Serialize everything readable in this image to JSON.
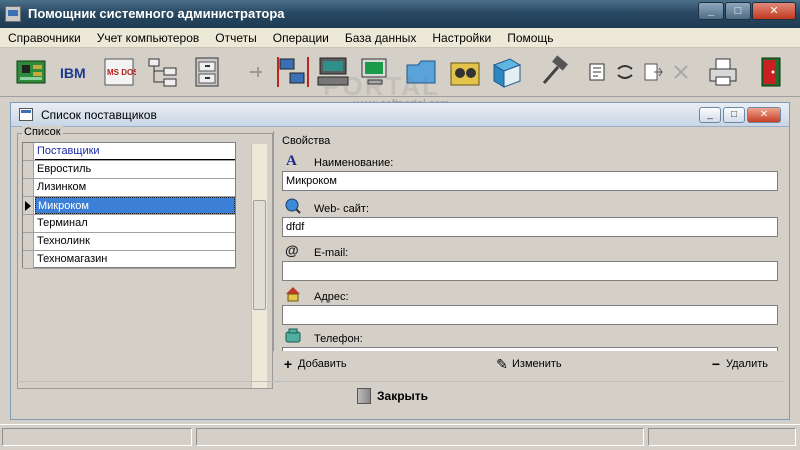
{
  "app": {
    "title": "Помощник системного администратора"
  },
  "window_buttons": {
    "minimize": "_",
    "maximize": "□",
    "close": "✕"
  },
  "menu": [
    {
      "label": "Справочники"
    },
    {
      "label": "Учет компьютеров"
    },
    {
      "label": "Отчеты"
    },
    {
      "label": "Операции"
    },
    {
      "label": "База данных"
    },
    {
      "label": "Настройки"
    },
    {
      "label": "Помощь"
    }
  ],
  "toolbar": {
    "ibm_label": "IBM",
    "msdos_label": "MS DOS",
    "watermark": "PORTAL",
    "watermark_url": "www.softportal.com"
  },
  "child_window": {
    "title": "Список поставщиков",
    "buttons": {
      "minimize": "_",
      "maximize": "□",
      "close": "✕"
    }
  },
  "list": {
    "legend": "Список",
    "header": "Поставщики",
    "rows": [
      "Евростиль",
      "Лизинком",
      "Микроком",
      "Терминал",
      "Технолинк",
      "Техномагазин"
    ],
    "selected": "Микроком"
  },
  "properties": {
    "title": "Свойства",
    "fields": [
      {
        "label": "Наименование:",
        "value": "Микроком"
      },
      {
        "label": "Web- сайт:",
        "value": "dfdf"
      },
      {
        "label": "E-mail:",
        "value": ""
      },
      {
        "label": "Адрес:",
        "value": ""
      },
      {
        "label": "Телефон:",
        "value": ""
      }
    ]
  },
  "actions": {
    "add": "Добавить",
    "edit": "Изменить",
    "delete": "Удалить"
  },
  "close_button": "Закрыть"
}
